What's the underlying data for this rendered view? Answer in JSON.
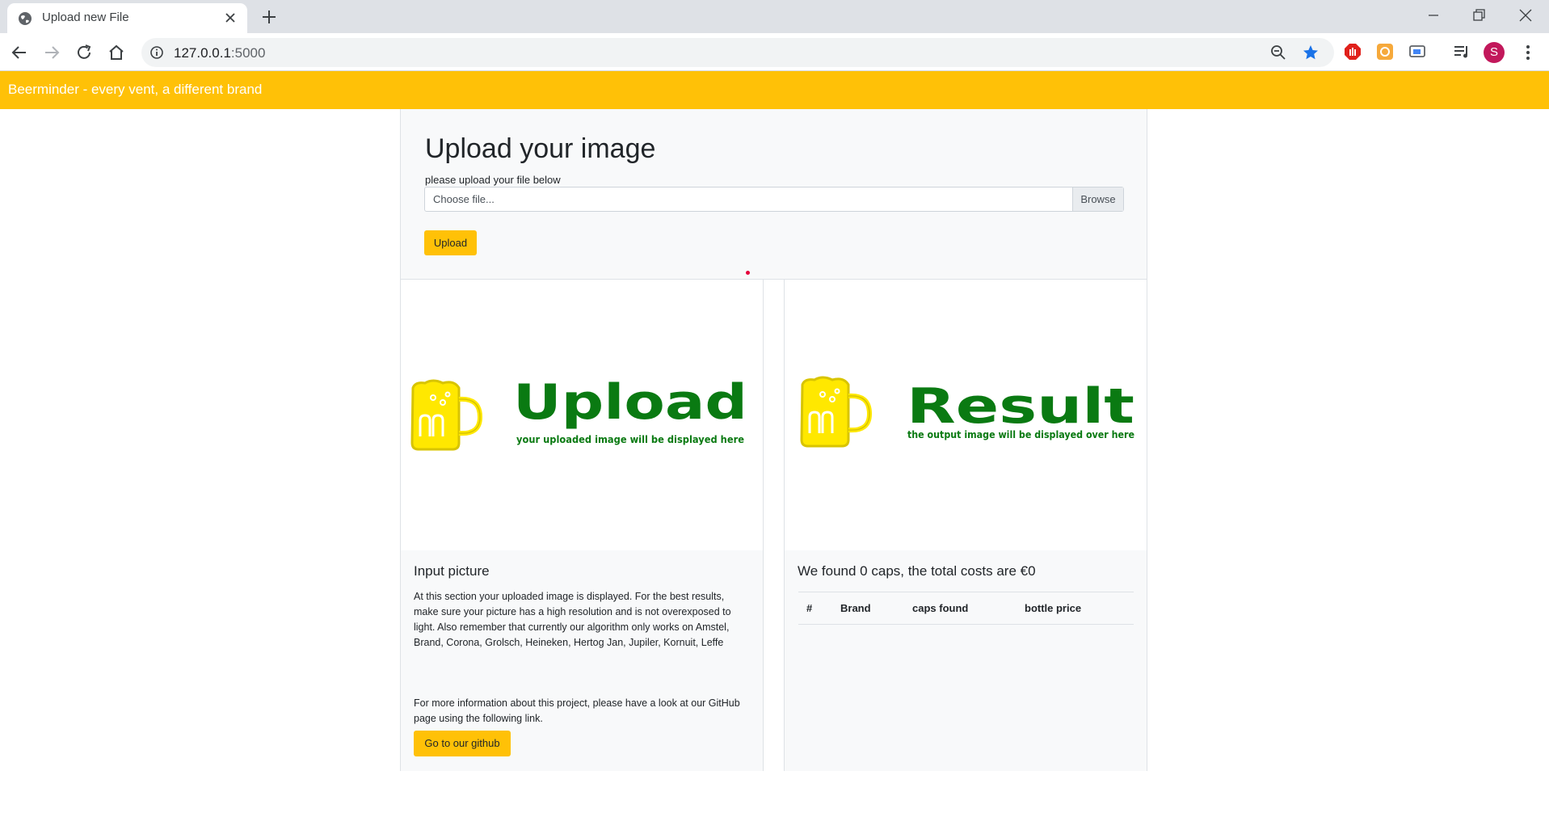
{
  "browser": {
    "tab_title": "Upload new File",
    "url_host": "127.0.0.1",
    "url_port": ":5000",
    "profile_initial": "S"
  },
  "navbar": {
    "brand": "Beerminder - every vent, a different brand"
  },
  "upload_form": {
    "heading": "Upload your image",
    "hint": "please upload your file below",
    "file_placeholder": "Choose file...",
    "browse_label": "Browse",
    "submit_label": "Upload"
  },
  "input_card": {
    "logo_word": "Upload",
    "logo_caption": "your uploaded image will be displayed here",
    "title": "Input picture",
    "text": "At this section your uploaded image is displayed. For the best results, make sure your picture has a high resolution and is not overexposed to light. Also remember that currently our algorithm only works on Amstel, Brand, Corona, Grolsch, Heineken, Hertog Jan, Jupiler, Kornuit, Leffe",
    "text2": "For more information about this project, please have a look at our GitHub page using the following link.",
    "button_label": "Go to our github"
  },
  "result_card": {
    "logo_word": "Result",
    "logo_caption": "the output image will be displayed over here",
    "title": "We found 0 caps, the total costs are €0",
    "table_headers": [
      "#",
      "Brand",
      "caps found",
      "bottle price"
    ],
    "rows": []
  },
  "colors": {
    "accent": "#ffc107",
    "logo_green": "#0a7a12",
    "logo_yellow": "#ffe800"
  }
}
